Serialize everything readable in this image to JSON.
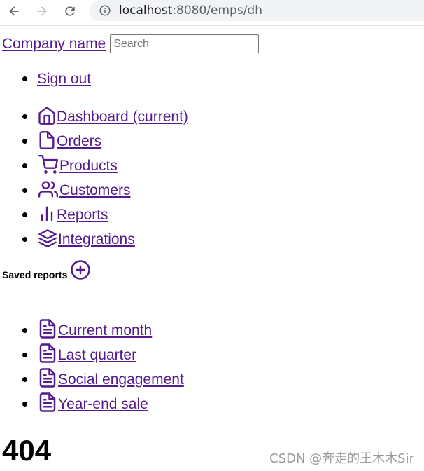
{
  "browser": {
    "url_host": "localhost",
    "url_rest": ":8080/emps/dh"
  },
  "header": {
    "brand": "Company name",
    "search_placeholder": "Search"
  },
  "account": {
    "sign_out": "Sign out"
  },
  "nav": {
    "items": [
      {
        "label": " Dashboard (current)",
        "icon": "home-icon"
      },
      {
        "label": " Orders",
        "icon": "file-icon"
      },
      {
        "label": " Products",
        "icon": "shopping-cart-icon"
      },
      {
        "label": " Customers",
        "icon": "users-icon"
      },
      {
        "label": " Reports",
        "icon": "bar-chart-icon"
      },
      {
        "label": " Integrations",
        "icon": "layers-icon"
      }
    ]
  },
  "saved_reports": {
    "heading": "Saved reports",
    "items": [
      {
        "label": " Current month",
        "icon": "file-text-icon"
      },
      {
        "label": " Last quarter",
        "icon": "file-text-icon"
      },
      {
        "label": " Social engagement",
        "icon": "file-text-icon"
      },
      {
        "label": " Year-end sale",
        "icon": "file-text-icon"
      }
    ]
  },
  "main": {
    "error_code": "404"
  },
  "watermark": "CSDN @奔走的王木木Sir",
  "colors": {
    "link": "#551a8b",
    "chrome_bg": "#f1f3f4"
  }
}
